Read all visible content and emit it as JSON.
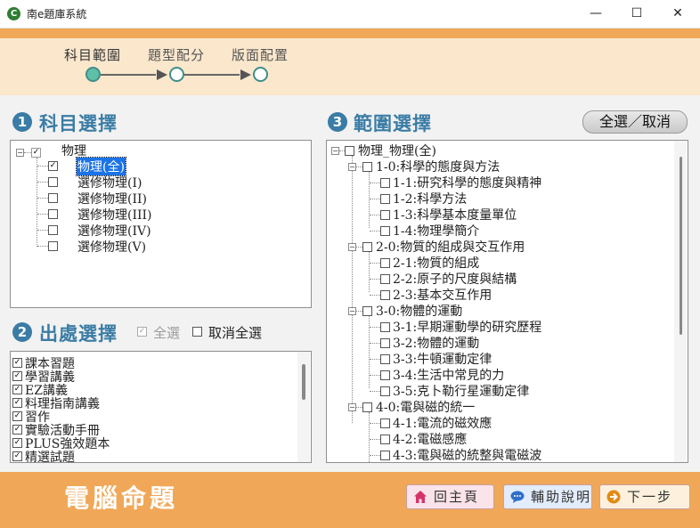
{
  "window": {
    "title": "南e題庫系統",
    "app_icon": "C",
    "controls": {
      "minimize": "—",
      "maximize": "☐",
      "close": "✕"
    }
  },
  "steps": [
    {
      "label": "科目範圍",
      "active": true
    },
    {
      "label": "題型配分",
      "active": false
    },
    {
      "label": "版面配置",
      "active": false
    }
  ],
  "subject": {
    "number": "1",
    "title": "科目選擇",
    "root": {
      "label": "物理",
      "expander": "−",
      "check": "✓"
    },
    "items": [
      {
        "label": "物理(全)",
        "checked": "✓",
        "selected": true
      },
      {
        "label": "選修物理(I)",
        "checked": ""
      },
      {
        "label": "選修物理(II)",
        "checked": ""
      },
      {
        "label": "選修物理(III)",
        "checked": ""
      },
      {
        "label": "選修物理(IV)",
        "checked": ""
      },
      {
        "label": "選修物理(V)",
        "checked": ""
      }
    ]
  },
  "source": {
    "number": "2",
    "title": "出處選擇",
    "select_all_label": "全選",
    "select_all_check": "✓",
    "deselect_all_label": "取消全選",
    "items": [
      {
        "label": "課本習題",
        "checked": "✓"
      },
      {
        "label": "學習講義",
        "checked": "✓"
      },
      {
        "label": "EZ講義",
        "checked": "✓"
      },
      {
        "label": "料理指南講義",
        "checked": "✓"
      },
      {
        "label": "習作",
        "checked": "✓"
      },
      {
        "label": "實驗活動手冊",
        "checked": "✓"
      },
      {
        "label": "PLUS強效題本",
        "checked": "✓"
      },
      {
        "label": "精選試題",
        "checked": "✓"
      }
    ]
  },
  "scope": {
    "number": "3",
    "title": "範圍選擇",
    "toggle_all_label": "全選／取消",
    "root": {
      "label": "物理_物理(全)",
      "expander": "−"
    },
    "chapters": [
      {
        "label": "1-0:科學的態度與方法",
        "expander": "−",
        "children": [
          "1-1:研究科學的態度與精神",
          "1-2:科學方法",
          "1-3:科學基本度量單位",
          "1-4:物理學簡介"
        ]
      },
      {
        "label": "2-0:物質的組成與交互作用",
        "expander": "−",
        "children": [
          "2-1:物質的組成",
          "2-2:原子的尺度與結構",
          "2-3:基本交互作用"
        ]
      },
      {
        "label": "3-0:物體的運動",
        "expander": "−",
        "children": [
          "3-1:早期運動學的研究歷程",
          "3-2:物體的運動",
          "3-3:牛頓運動定律",
          "3-4:生活中常見的力",
          "3-5:克卜勒行星運動定律"
        ]
      },
      {
        "label": "4-0:電與磁的統一",
        "expander": "−",
        "children": [
          "4-1:電流的磁效應",
          "4-2:電磁感應",
          "4-3:電與磁的統整與電磁波"
        ]
      }
    ]
  },
  "footer": {
    "title": "電腦命題",
    "home_label": "回主頁",
    "home_icon": "home-icon",
    "help_label": "輔助說明",
    "help_icon": "chat-bubble-icon",
    "next_label": "下一步",
    "next_icon": "arrow-right-circle-icon"
  },
  "colors": {
    "accent_orange": "#f0a858",
    "stepper_bg": "#fbe7cc",
    "section_blue": "#3a7ca5",
    "selection_blue": "#1a73e8",
    "step_dot_active": "#5fc0a8"
  }
}
